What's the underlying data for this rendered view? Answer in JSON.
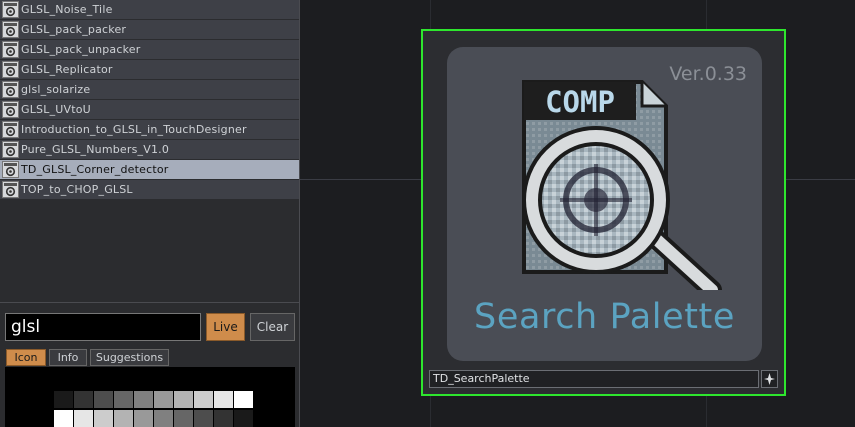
{
  "search_panel": {
    "results": [
      {
        "label": "GLSL_Noise_Tile",
        "op_icon": "comp-operator-icon",
        "selected": false
      },
      {
        "label": "GLSL_pack_packer",
        "op_icon": "comp-operator-icon",
        "selected": false
      },
      {
        "label": "GLSL_pack_unpacker",
        "op_icon": "comp-operator-icon",
        "selected": false
      },
      {
        "label": "GLSL_Replicator",
        "op_icon": "comp-operator-icon",
        "selected": false
      },
      {
        "label": "glsl_solarize",
        "op_icon": "comp-operator-icon",
        "selected": false
      },
      {
        "label": "GLSL_UVtoU",
        "op_icon": "comp-operator-icon",
        "selected": false
      },
      {
        "label": "Introduction_to_GLSL_in_TouchDesigner",
        "op_icon": "comp-operator-icon",
        "selected": false
      },
      {
        "label": "Pure_GLSL_Numbers_V1.0",
        "op_icon": "comp-operator-icon",
        "selected": false
      },
      {
        "label": "TD_GLSL_Corner_detector",
        "op_icon": "top-operator-icon",
        "selected": true
      },
      {
        "label": "TOP_to_CHOP_GLSL",
        "op_icon": "comp-operator-icon",
        "selected": false
      }
    ],
    "search": {
      "value": "glsl",
      "placeholder": ""
    },
    "live_label": "Live",
    "clear_label": "Clear",
    "tabs": [
      {
        "label": "Icon",
        "active": true
      },
      {
        "label": "Info",
        "active": false
      },
      {
        "label": "Suggestions",
        "active": false
      }
    ],
    "preview_swatches": {
      "top_row": [
        "#1a1a1a",
        "#333333",
        "#4d4d4d",
        "#666666",
        "#808080",
        "#999999",
        "#b3b3b3",
        "#cccccc",
        "#e6e6e6",
        "#ffffff"
      ],
      "bottom_row": [
        "#ffffff",
        "#e6e6e6",
        "#cccccc",
        "#b3b3b3",
        "#999999",
        "#808080",
        "#666666",
        "#4d4d4d",
        "#333333",
        "#1a1a1a"
      ]
    }
  },
  "network": {
    "node": {
      "name": "TD_SearchPalette",
      "version": "Ver.0.33",
      "app_title": "Search Palette",
      "icon_badge": "COMP",
      "border_color": "#2ee62e",
      "title_color": "#5ba3c1"
    }
  }
}
